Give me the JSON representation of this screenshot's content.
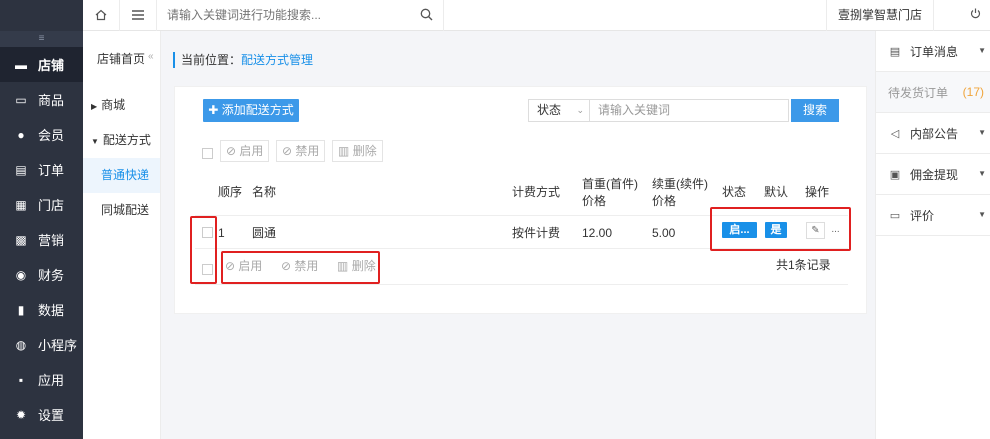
{
  "topbar": {
    "search_placeholder": "请输入关键词进行功能搜索...",
    "store_name": "壹捌掌智慧门店"
  },
  "leftnav": {
    "collapse_icon": "≡",
    "items": [
      {
        "label": "店铺",
        "icon": "store-icon",
        "glyph": "▬",
        "active": true
      },
      {
        "label": "商品",
        "icon": "goods-icon",
        "glyph": "▭"
      },
      {
        "label": "会员",
        "icon": "user-icon",
        "glyph": "●"
      },
      {
        "label": "订单",
        "icon": "order-icon",
        "glyph": "▤"
      },
      {
        "label": "门店",
        "icon": "shop-icon",
        "glyph": "▦"
      },
      {
        "label": "营销",
        "icon": "gift-icon",
        "glyph": "▩"
      },
      {
        "label": "财务",
        "icon": "money-bag-icon",
        "glyph": "◉"
      },
      {
        "label": "数据",
        "icon": "bar-chart-icon",
        "glyph": "▮"
      },
      {
        "label": "小程序",
        "icon": "miniprogram-icon",
        "glyph": "◍"
      },
      {
        "label": "应用",
        "icon": "apps-icon",
        "glyph": "▪"
      },
      {
        "label": "设置",
        "icon": "gear-icon",
        "glyph": "✹"
      }
    ]
  },
  "subnav": {
    "header": "店铺首页",
    "group1": "商城",
    "group2": "配送方式",
    "item1": "普通快递",
    "item2": "同城配送"
  },
  "breadcrumb": {
    "prefix": "当前位置：",
    "current": "配送方式管理"
  },
  "toolbar": {
    "add_label": "添加配送方式",
    "status_label": "状态",
    "keyword_placeholder": "请输入关键词",
    "search_label": "搜索"
  },
  "batch": {
    "enable": "启用",
    "disable": "禁用",
    "delete": "删除"
  },
  "table": {
    "headers": {
      "order": "顺序",
      "name": "名称",
      "billing": "计费方式",
      "first_weight": "首重(首件)",
      "first_weight_2": "价格",
      "extra_weight": "续重(续件)",
      "extra_weight_2": "价格",
      "status": "状态",
      "default": "默认",
      "actions": "操作"
    },
    "rows": [
      {
        "order": "1",
        "name": "圆通",
        "billing": "按件计费",
        "first_price": "12.00",
        "extra_price": "5.00",
        "status": "启...",
        "default": "是",
        "more": "..."
      }
    ],
    "total": "共1条记录"
  },
  "rightpanel": {
    "items": [
      {
        "label": "订单消息",
        "icon": "clipboard-icon"
      },
      {
        "label": "内部公告",
        "icon": "megaphone-icon"
      },
      {
        "label": "佣金提现",
        "icon": "withdraw-icon"
      },
      {
        "label": "评价",
        "icon": "comment-icon"
      }
    ],
    "pending_label": "待发货订单",
    "pending_count": "(17)"
  },
  "colors": {
    "accent": "#1990e8",
    "highlight": "#e02020",
    "sidebar": "#2d3340"
  }
}
